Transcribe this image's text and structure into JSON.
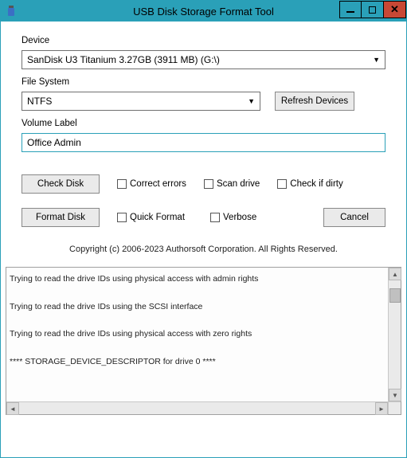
{
  "window": {
    "title": "USB Disk Storage Format Tool"
  },
  "labels": {
    "device": "Device",
    "filesystem": "File System",
    "volume": "Volume Label"
  },
  "device": {
    "selected": "SanDisk U3 Titanium 3.27GB (3911 MB)  (G:\\)"
  },
  "filesystem": {
    "selected": "NTFS"
  },
  "volume": {
    "value": "Office Admin"
  },
  "buttons": {
    "refresh": "Refresh Devices",
    "checkdisk": "Check Disk",
    "formatdisk": "Format Disk",
    "cancel": "Cancel"
  },
  "checkboxes": {
    "correct": "Correct errors",
    "scan": "Scan drive",
    "dirty": "Check if dirty",
    "quick": "Quick Format",
    "verbose": "Verbose"
  },
  "copyright": "Copyright (c) 2006-2023 Authorsoft Corporation. All Rights Reserved.",
  "log": [
    "Trying to read the drive IDs using physical access with admin rights",
    "Trying to read the drive IDs using the SCSI interface",
    "Trying to read the drive IDs using physical access with zero rights",
    "**** STORAGE_DEVICE_DESCRIPTOR for drive 0 ****"
  ]
}
